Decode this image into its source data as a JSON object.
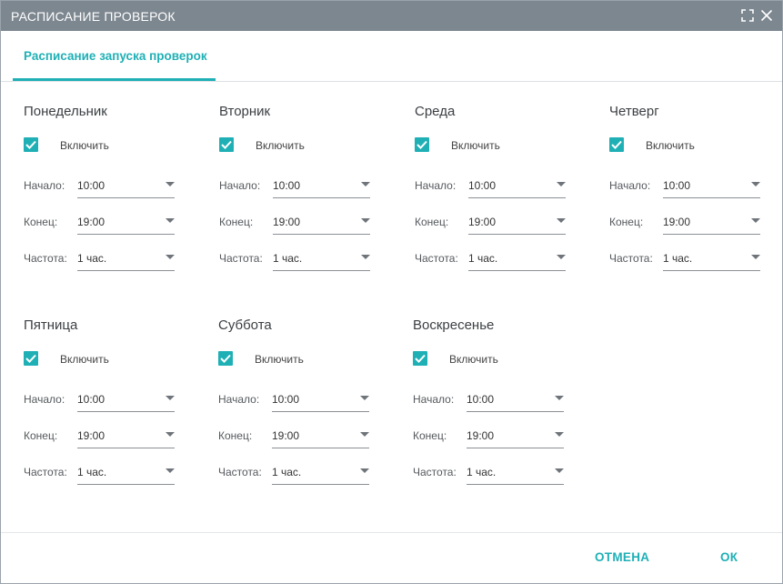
{
  "window": {
    "title": "РАСПИСАНИЕ ПРОВЕРОК",
    "icons": [
      "maximize-icon",
      "close-icon"
    ]
  },
  "tabs": [
    {
      "label": "Расписание запуска проверок",
      "active": true
    }
  ],
  "labels": {
    "enable": "Включить",
    "start": "Начало:",
    "end": "Конец:",
    "frequency": "Частота:"
  },
  "days": [
    {
      "name": "Понедельник",
      "enabled": true,
      "start": "10:00",
      "end": "19:00",
      "frequency": "1 час."
    },
    {
      "name": "Вторник",
      "enabled": true,
      "start": "10:00",
      "end": "19:00",
      "frequency": "1 час."
    },
    {
      "name": "Среда",
      "enabled": true,
      "start": "10:00",
      "end": "19:00",
      "frequency": "1 час."
    },
    {
      "name": "Четверг",
      "enabled": true,
      "start": "10:00",
      "end": "19:00",
      "frequency": "1 час."
    },
    {
      "name": "Пятница",
      "enabled": true,
      "start": "10:00",
      "end": "19:00",
      "frequency": "1 час."
    },
    {
      "name": "Суббота",
      "enabled": true,
      "start": "10:00",
      "end": "19:00",
      "frequency": "1 час."
    },
    {
      "name": "Воскресенье",
      "enabled": true,
      "start": "10:00",
      "end": "19:00",
      "frequency": "1 час."
    }
  ],
  "footer": {
    "cancel": "ОТМЕНА",
    "ok": "ОК"
  },
  "colors": {
    "accent": "#1fb0b6",
    "titlebar": "#7d8790"
  }
}
